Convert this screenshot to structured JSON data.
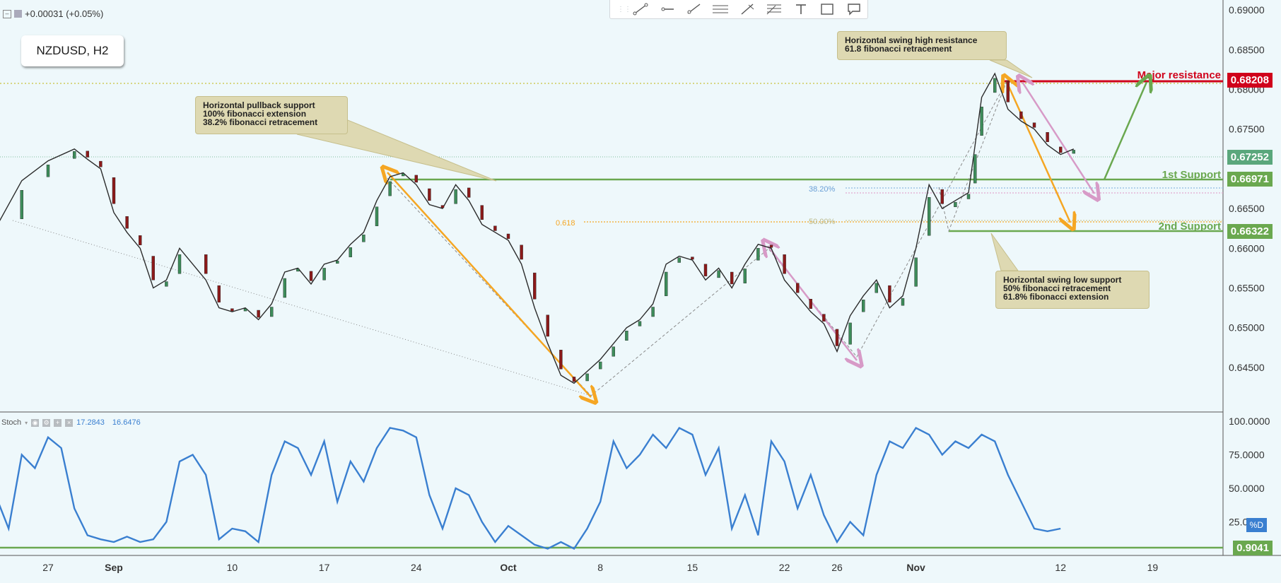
{
  "header": {
    "change": "+0.00031 (+0.05%)",
    "symbol": "NZDUSD, H2"
  },
  "toolbar": {
    "tools": [
      "trend-line-icon",
      "horizontal-ray-icon",
      "ray-icon",
      "parallel-channel-icon",
      "pitchfork-icon",
      "fib-retracement-icon",
      "text-icon",
      "rectangle-icon",
      "callout-icon"
    ]
  },
  "price_axis": {
    "ticks": [
      "0.69000",
      "0.68500",
      "0.68000",
      "0.67500",
      "0.66500",
      "0.66000",
      "0.65500",
      "0.65000",
      "0.64500"
    ]
  },
  "time_axis": {
    "ticks": [
      {
        "label": "27",
        "day": -5
      },
      {
        "label": "Sep",
        "day": 0
      },
      {
        "label": "10",
        "day": 9
      },
      {
        "label": "17",
        "day": 16
      },
      {
        "label": "24",
        "day": 23
      },
      {
        "label": "Oct",
        "day": 30
      },
      {
        "label": "8",
        "day": 37
      },
      {
        "label": "15",
        "day": 44
      },
      {
        "label": "22",
        "day": 51
      },
      {
        "label": "26",
        "day": 55
      },
      {
        "label": "Nov",
        "day": 61
      },
      {
        "label": "12",
        "day": 72
      },
      {
        "label": "19",
        "day": 79
      }
    ]
  },
  "levels": {
    "major_resistance": {
      "label": "Major resistance",
      "value": "0.68208",
      "color": "#d0021b"
    },
    "current": {
      "value": "0.67252",
      "color": "#5aa77c"
    },
    "first_support": {
      "label": "1st Support",
      "value": "0.66971",
      "color": "#6aa84f"
    },
    "second_support": {
      "label": "2nd Support",
      "value": "0.66322",
      "color": "#6aa84f"
    },
    "stoch_level": {
      "value": "0.9041",
      "color": "#6aa84f"
    }
  },
  "fib_labels": {
    "f382": "38.20%",
    "f500": "50.00%",
    "f618": "0.618"
  },
  "notes": {
    "resistance": [
      "Horizontal swing high resistance",
      "61.8 fibonacci retracement"
    ],
    "pullback": [
      "Horizontal pullback support",
      "100% fibonacci extension",
      "38.2% fibonacci retracement"
    ],
    "swing_low": [
      "Horizontal swing low support",
      "50% fibonacci retracement",
      "61.8% fibonacci extension"
    ]
  },
  "stoch": {
    "name": "Stoch",
    "k": "17.2843",
    "d": "16.6476",
    "d_label": "%D",
    "ticks": [
      "100.0000",
      "75.0000",
      "50.0000",
      "25.0000"
    ]
  },
  "chart_data": {
    "type": "line",
    "title": "NZDUSD, H2",
    "x_unit": "days since Sep 1",
    "price_ylim": [
      0.6425,
      0.6905
    ],
    "price": {
      "x": [
        -9,
        -7,
        -5,
        -3,
        -2,
        -1,
        0,
        1,
        2,
        3,
        4,
        5,
        7,
        8,
        9,
        10,
        11,
        12,
        13,
        14,
        15,
        16,
        17,
        18,
        19,
        20,
        21,
        22,
        23,
        24,
        25,
        26,
        27,
        28,
        29,
        30,
        31,
        32,
        33,
        34,
        35,
        36,
        37,
        38,
        39,
        40,
        41,
        42,
        43,
        44,
        45,
        46,
        47,
        48,
        49,
        50,
        51,
        52,
        53,
        54,
        55,
        56,
        57,
        58,
        59,
        60,
        61,
        62,
        63,
        64,
        65,
        65.5,
        66,
        67,
        68,
        69,
        70,
        71,
        72,
        73
      ],
      "y": [
        0.6625,
        0.6685,
        0.671,
        0.6725,
        0.6712,
        0.67,
        0.6645,
        0.662,
        0.66,
        0.655,
        0.656,
        0.66,
        0.656,
        0.6525,
        0.652,
        0.6525,
        0.651,
        0.653,
        0.657,
        0.6575,
        0.6555,
        0.658,
        0.6585,
        0.6605,
        0.662,
        0.666,
        0.669,
        0.6695,
        0.668,
        0.6655,
        0.665,
        0.668,
        0.666,
        0.663,
        0.662,
        0.661,
        0.658,
        0.6525,
        0.648,
        0.644,
        0.643,
        0.6445,
        0.646,
        0.648,
        0.65,
        0.651,
        0.653,
        0.658,
        0.659,
        0.6585,
        0.656,
        0.6575,
        0.655,
        0.658,
        0.6605,
        0.66,
        0.656,
        0.654,
        0.652,
        0.6505,
        0.647,
        0.6515,
        0.654,
        0.656,
        0.6525,
        0.654,
        0.66,
        0.668,
        0.665,
        0.666,
        0.667,
        0.673,
        0.679,
        0.682,
        0.6775,
        0.676,
        0.675,
        0.673,
        0.6718,
        0.6725
      ]
    },
    "stoch_ylim": [
      0,
      100
    ],
    "stoch": {
      "x": [
        -9,
        -8,
        -7,
        -6,
        -5,
        -4,
        -3,
        -2,
        -1,
        0,
        1,
        2,
        3,
        4,
        5,
        6,
        7,
        8,
        9,
        10,
        11,
        12,
        13,
        14,
        15,
        16,
        17,
        18,
        19,
        20,
        21,
        22,
        23,
        24,
        25,
        26,
        27,
        28,
        29,
        30,
        31,
        32,
        33,
        34,
        35,
        36,
        37,
        38,
        39,
        40,
        41,
        42,
        43,
        44,
        45,
        46,
        47,
        48,
        49,
        50,
        51,
        52,
        53,
        54,
        55,
        56,
        57,
        58,
        59,
        60,
        61,
        62,
        63,
        64,
        65,
        66,
        67,
        68,
        69,
        70,
        71,
        72
      ],
      "y": [
        45,
        20,
        75,
        65,
        88,
        80,
        35,
        15,
        12,
        10,
        14,
        10,
        12,
        25,
        70,
        75,
        60,
        12,
        20,
        18,
        10,
        60,
        85,
        80,
        60,
        85,
        40,
        70,
        55,
        80,
        95,
        93,
        88,
        45,
        20,
        50,
        45,
        25,
        10,
        22,
        15,
        8,
        5,
        10,
        5,
        20,
        40,
        85,
        65,
        75,
        90,
        80,
        95,
        90,
        60,
        80,
        20,
        45,
        15,
        85,
        70,
        35,
        60,
        30,
        10,
        25,
        15,
        60,
        85,
        80,
        95,
        90,
        75,
        85,
        80,
        90,
        85,
        60,
        40,
        20,
        18,
        20
      ]
    },
    "horizontal_levels": [
      0.68208,
      0.66971,
      0.66322
    ],
    "current_price": 0.67252
  }
}
